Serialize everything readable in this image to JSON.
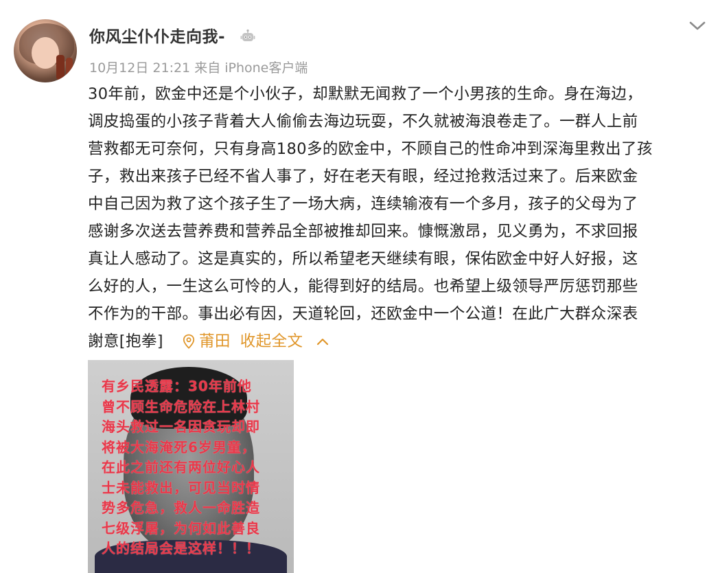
{
  "post": {
    "username": "你风尘仆仆走向我-",
    "meta": "10月12日 21:21 来自 iPhone客户端",
    "body_lines": [
      "30年前，欧金中还是个小伙子，却默默无闻救了一个小男孩的生命。身在海边，",
      "调皮捣蛋的小孩子背着大人偷偷去海边玩耍，不久就被海浪卷走了。一群人上前",
      "营救都无可奈何，只有身高180多的欧金中，不顾自己的性命冲到深海里救出了孩",
      "子，救出来孩子已经不省人事了，好在老天有眼，经过抢救活过来了。后来欧金",
      "中自己因为救了这个孩子生了一场大病，连续输液有一个多月，孩子的父母为了",
      "感谢多次送去营养费和营养品全部被推却回来。慷慨激昂，见义勇为，不求回报",
      "真让人感动了。这是真实的，所以希望老天继续有眼，保佑欧金中好人好报，这",
      "么好的人，一生这么可怜的人，能得到好的结局。也希望上级领导严厉惩罚那些",
      "不作为的干部。事出必有因，天道轮回，还欧金中一个公道！在此广大群众深表"
    ],
    "last_line": "謝意[抱拳]",
    "location": "莆田",
    "collapse_label": "收起全文"
  },
  "image_overlay": {
    "lines": [
      "有乡民透露：30年前他",
      "曾不顾生命危险在上林村",
      "海头救过一名因贪玩却即",
      "将被大海淹死6岁男童，",
      "在此之前还有两位好心人",
      "士未能救出，可见当时情",
      "势多危急，救人一命胜造",
      "七级浮屠，为何如此善良",
      "人的结局会是这样！！！"
    ]
  },
  "icons": {
    "verified": "robot-icon",
    "menu": "chevron-down-icon",
    "location": "location-pin-icon",
    "collapse": "chevron-up-icon"
  },
  "colors": {
    "accent": "#e0962a",
    "meta": "#9a9a9a",
    "overlay_text": "#e8384a"
  }
}
